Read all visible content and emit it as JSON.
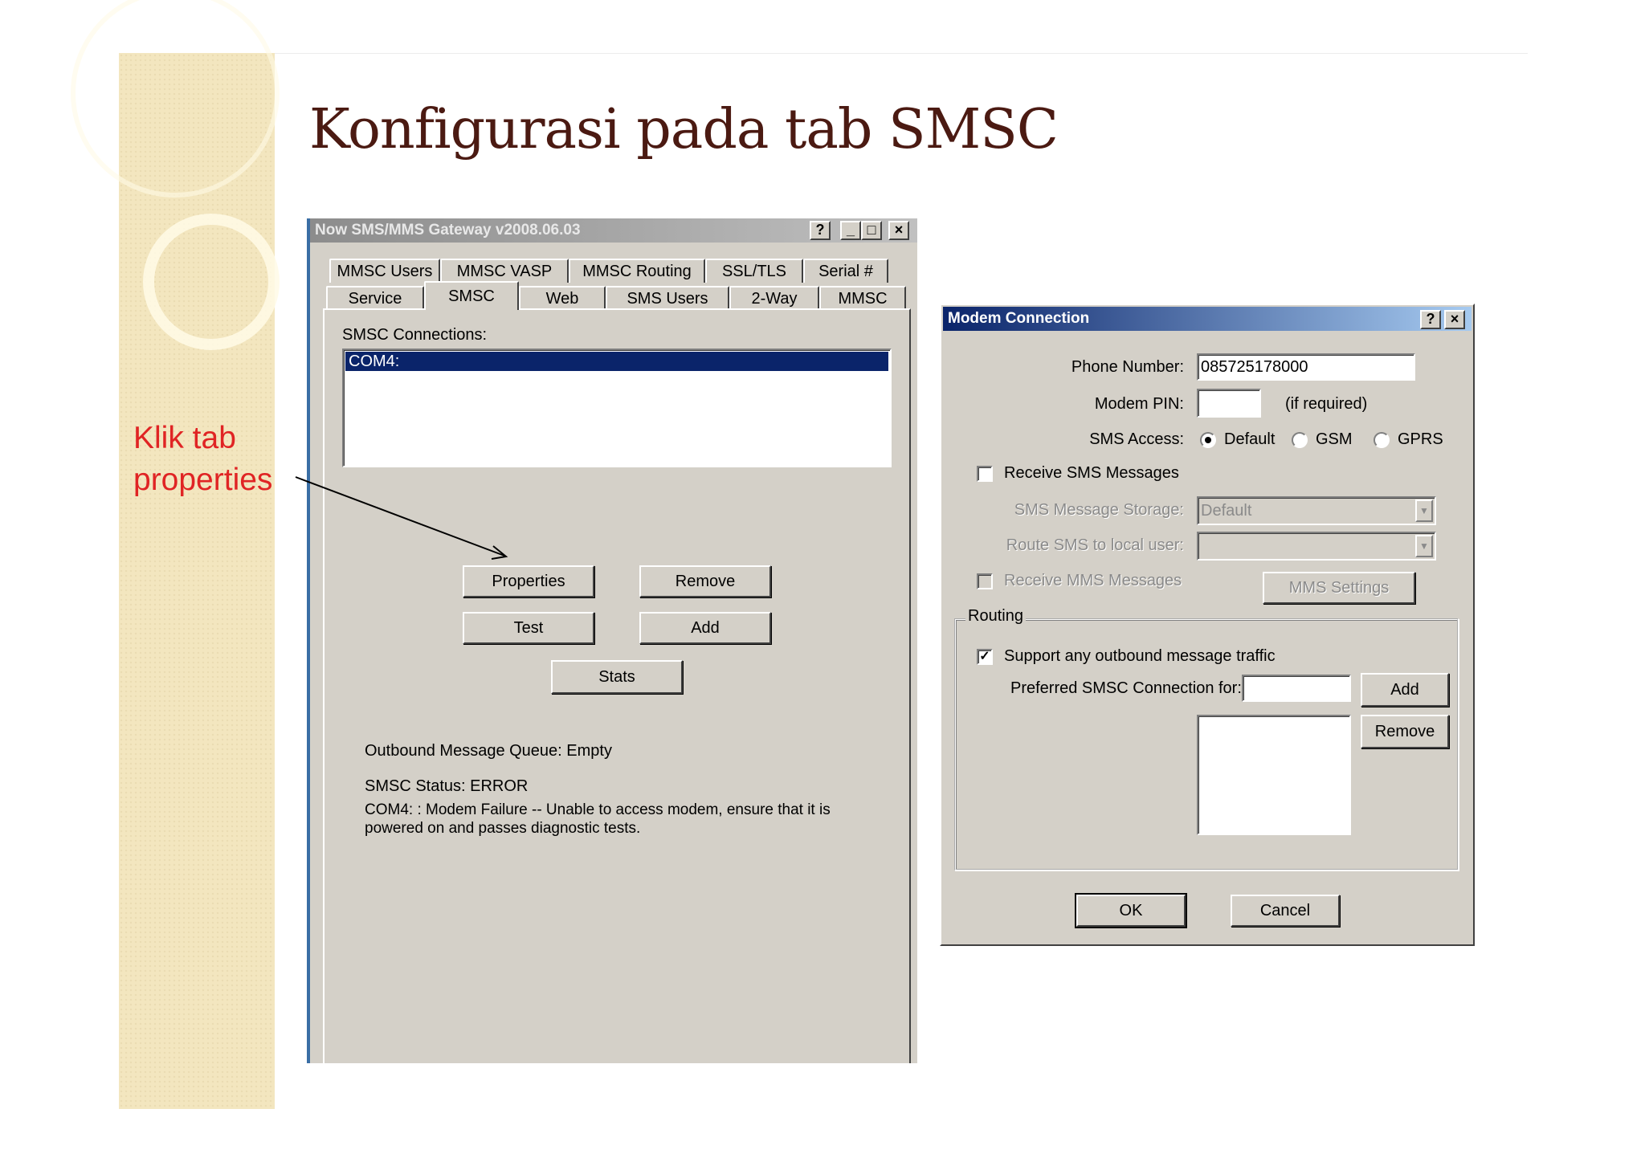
{
  "slide": {
    "title": "Konfigurasi pada tab SMSC",
    "callout_line1": "Klik tab",
    "callout_line2": "properties"
  },
  "gateway": {
    "title": "Now SMS/MMS Gateway v2008.06.03",
    "tabs_row1": [
      "MMSC Users",
      "MMSC VASP",
      "MMSC Routing",
      "SSL/TLS",
      "Serial #"
    ],
    "tabs_row2": [
      "Service",
      "SMSC",
      "Web",
      "SMS Users",
      "2-Way",
      "MMSC"
    ],
    "active_tab": "SMSC",
    "connections_label": "SMSC Connections:",
    "connections": [
      "COM4:"
    ],
    "buttons": {
      "properties": "Properties",
      "remove": "Remove",
      "test": "Test",
      "add": "Add",
      "stats": "Stats"
    },
    "queue": "Outbound Message Queue:  Empty",
    "status": "SMSC Status:  ERROR",
    "error_line1": "COM4: : Modem Failure -- Unable to access modem, ensure that it is",
    "error_line2": "powered on and passes diagnostic tests."
  },
  "modem": {
    "title": "Modem Connection",
    "phone_label": "Phone Number:",
    "phone_value": "085725178000",
    "pin_label": "Modem PIN:",
    "pin_value": "",
    "pin_hint": "(if required)",
    "sms_access_label": "SMS Access:",
    "access_options": [
      "Default",
      "GSM",
      "GPRS"
    ],
    "access_selected": "Default",
    "receive_sms_label": "Receive SMS Messages",
    "receive_sms": false,
    "storage_label": "SMS Message Storage:",
    "storage_value": "Default",
    "route_label": "Route SMS to local user:",
    "route_value": "",
    "receive_mms_label": "Receive MMS Messages",
    "mms_settings": "MMS Settings",
    "routing_label": "Routing",
    "support_outbound_label": "Support any outbound message traffic",
    "support_outbound": true,
    "preferred_label": "Preferred SMSC Connection for:",
    "preferred_value": "",
    "add": "Add",
    "remove": "Remove",
    "ok": "OK",
    "cancel": "Cancel"
  },
  "colors": {
    "slide_title": "#4b1a12",
    "callout": "#e02424",
    "sidebar": "#f3e6bf",
    "win_face": "#d4d0c8",
    "active_title_start": "#0a246a",
    "active_title_end": "#a6caf0",
    "selection": "#0a246a"
  }
}
